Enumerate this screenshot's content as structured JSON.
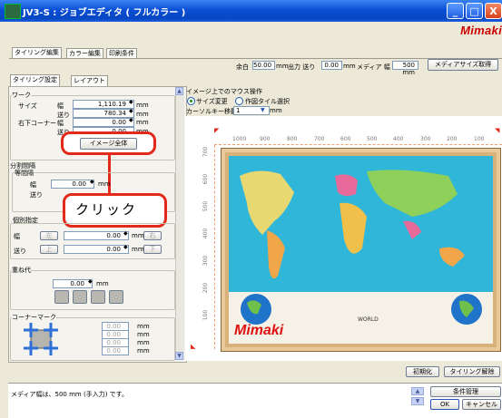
{
  "window": {
    "title": "JV3-S : ジョブエディタ ( フルカラー )",
    "logo": "Mimaki"
  },
  "title_buttons": {
    "minimize": "_",
    "maximize": "□",
    "close": "X"
  },
  "main_tabs": [
    "タイリング編集",
    "カラー編集",
    "印刷条件"
  ],
  "media_bar": {
    "margin_label": "余白",
    "margin_value": "50.00",
    "margin_unit": "mm",
    "feed_label": "出力 送り",
    "feed_value": "0.00",
    "feed_unit": "mm",
    "media_label": "メディア 幅",
    "media_value": "500 mm",
    "get_size_button": "メディアサイズ取得"
  },
  "sub_tabs": [
    "タイリング設定",
    "レイアウト"
  ],
  "work": {
    "group": "ワーク",
    "size_label": "サイズ",
    "width_label": "幅",
    "width_value": "1,110.19",
    "feed_label": "送り",
    "feed_value": "780.34",
    "corner_label": "右下コーナー",
    "corner_width_label": "幅",
    "corner_width_value": "0.00",
    "corner_feed_label": "送り",
    "corner_feed_value": "0.00",
    "unit": "mm",
    "whole_image_button": "イメージ全体"
  },
  "split": {
    "group": "分割間隔",
    "equal_group": "等間隔",
    "width_label": "幅",
    "width_value": "0.00",
    "feed_label": "送り",
    "unit": "mm"
  },
  "individual": {
    "group": "個別指定",
    "width_label": "幅",
    "left": "左",
    "width_value": "0.00",
    "right": "右",
    "feed_label": "送り",
    "top": "上",
    "feed_value": "0.00",
    "bottom": "下",
    "unit": "mm"
  },
  "overlap": {
    "group": "重ね代",
    "value": "0.00",
    "unit": "mm"
  },
  "corner_mark": {
    "group": "コーナーマーク",
    "values": [
      "0.00",
      "0.00",
      "0.00",
      "0.00"
    ],
    "unit": "mm"
  },
  "mouse_op": {
    "header": "イメージ上でのマウス操作",
    "option1": "サイズ変更",
    "option2": "作図タイル選択",
    "cursor_label": "カーソルキー移動量",
    "cursor_value": "1",
    "cursor_unit": "mm"
  },
  "ruler": [
    "1000",
    "900",
    "800",
    "700",
    "600",
    "500",
    "400",
    "300",
    "200",
    "100"
  ],
  "ruler_v": [
    "700",
    "600",
    "500",
    "400",
    "300",
    "200",
    "100"
  ],
  "callout": {
    "text": "クリック"
  },
  "bottom_buttons": {
    "init": "初期化",
    "release": "タイリング解除"
  },
  "status": {
    "message": "メディア幅は、500 mm (手入力) です。",
    "condition_button": "条件管理",
    "ok_button": "OK",
    "cancel_button": "キャンセル"
  },
  "map": {
    "brand": "Mimaki",
    "globe_text": "WORLD"
  },
  "colors": {
    "titlebar": "#0a4fd6",
    "callout": "#e32a1a",
    "ocean": "#2fb6d8"
  }
}
